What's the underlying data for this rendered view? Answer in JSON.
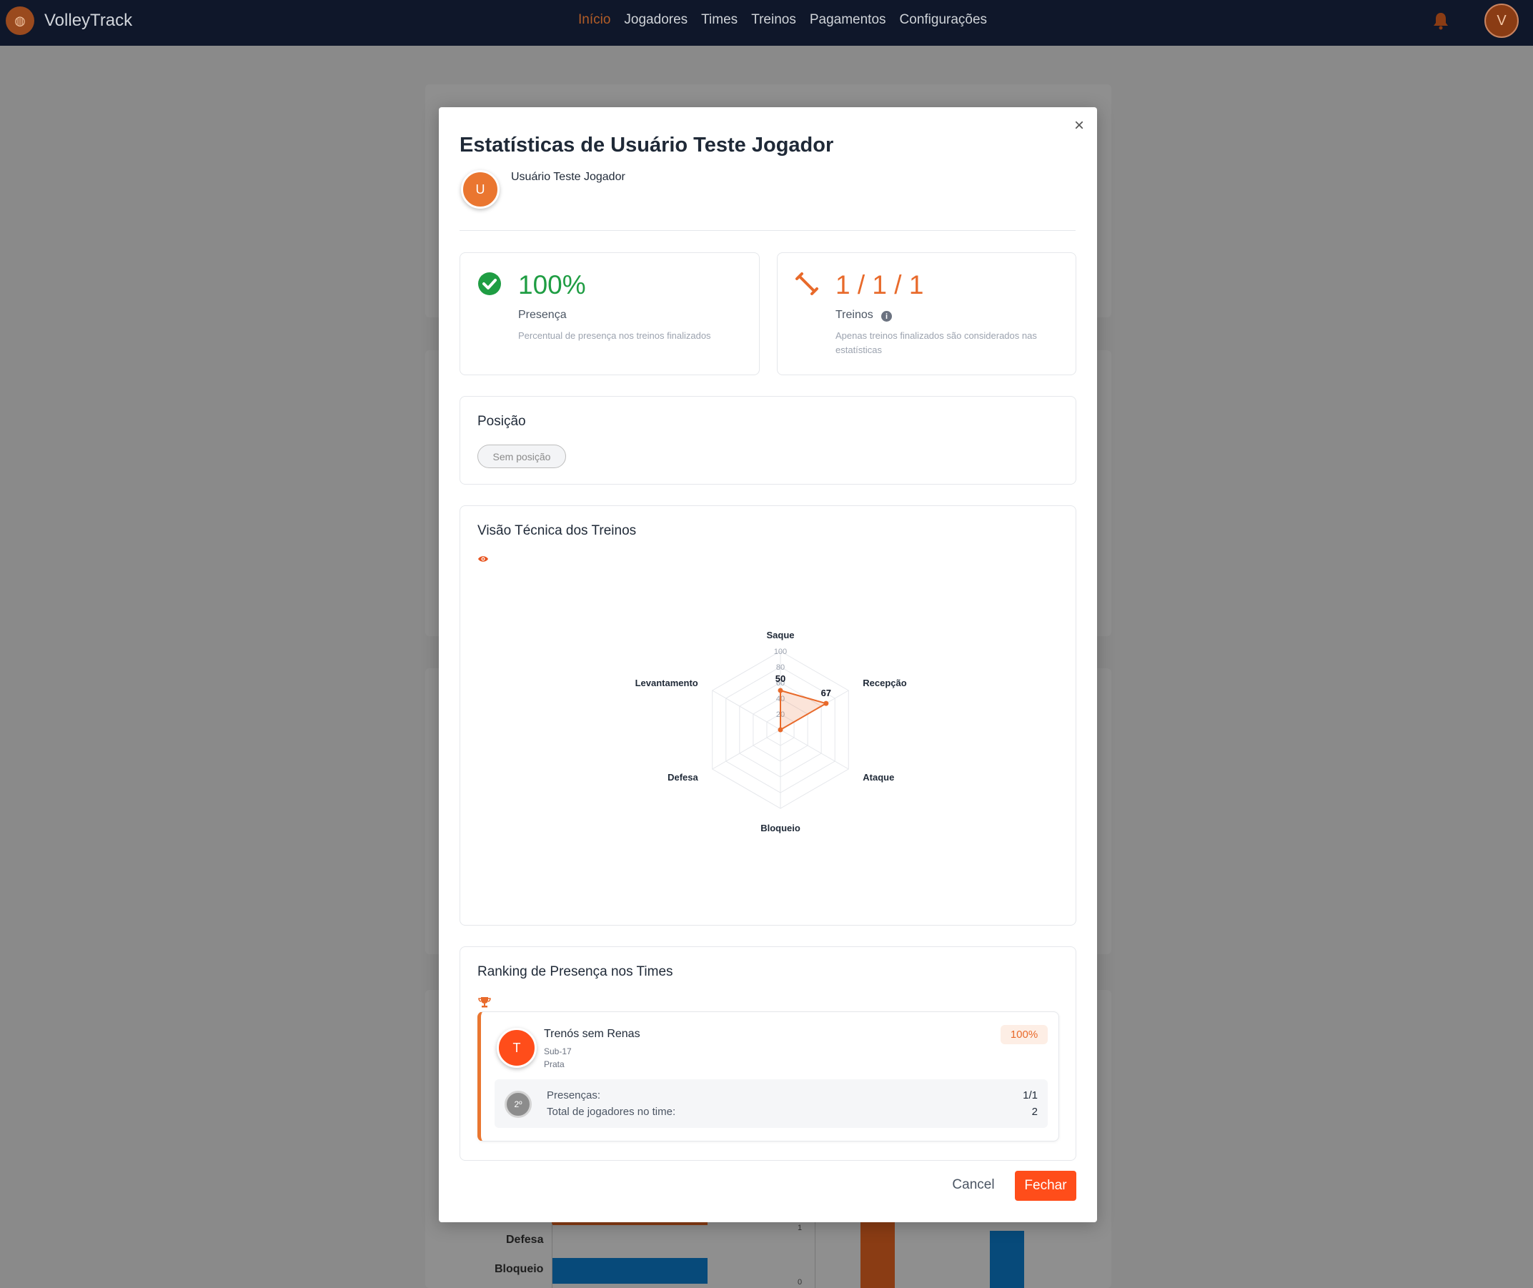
{
  "app": {
    "name": "VolleyTrack",
    "nav": [
      "Início",
      "Jogadores",
      "Times",
      "Treinos",
      "Pagamentos",
      "Configurações"
    ],
    "active_nav": "Início",
    "user_initial": "V"
  },
  "background": {
    "bar_labels": [
      "Defesa",
      "Bloqueio"
    ],
    "axis_ticks": [
      "1",
      "0"
    ]
  },
  "modal": {
    "title": "Estatísticas de Usuário Teste Jogador",
    "close_symbol": "×",
    "user": {
      "initial": "U",
      "name": "Usuário Teste Jogador"
    },
    "presence": {
      "value": "100%",
      "label": "Presença",
      "description": "Percentual de presença nos treinos finalizados"
    },
    "trainings": {
      "value": "1 / 1 / 1",
      "label": "Treinos",
      "description_line1": "Apenas treinos finalizados são considerados nas",
      "description_line2": "estatísticas"
    },
    "position": {
      "title": "Posição",
      "value": "Sem posição"
    },
    "technical": {
      "title": "Visão Técnica dos Treinos"
    },
    "ranking": {
      "title": "Ranking de Presença nos Times",
      "team": {
        "initial": "T",
        "name": "Trenós sem Renas",
        "category": "Sub-17",
        "level": "Prata",
        "badge": "100%",
        "rank": "2º",
        "presence_label": "Presenças:",
        "presence_value": "1/1",
        "total_label": "Total de jogadores no time:",
        "total_value": "2"
      }
    },
    "buttons": {
      "cancel": "Cancel",
      "close": "Fechar"
    }
  },
  "chart_data": {
    "type": "radar",
    "categories": [
      "Saque",
      "Recepção",
      "Ataque",
      "Bloqueio",
      "Defesa",
      "Levantamento"
    ],
    "values": [
      50,
      67,
      0,
      0,
      0,
      0
    ],
    "value_labels": [
      "50",
      "67"
    ],
    "ticks": [
      "20",
      "40",
      "60",
      "80",
      "100"
    ],
    "range": [
      0,
      100
    ],
    "color": "#e86a2b"
  }
}
